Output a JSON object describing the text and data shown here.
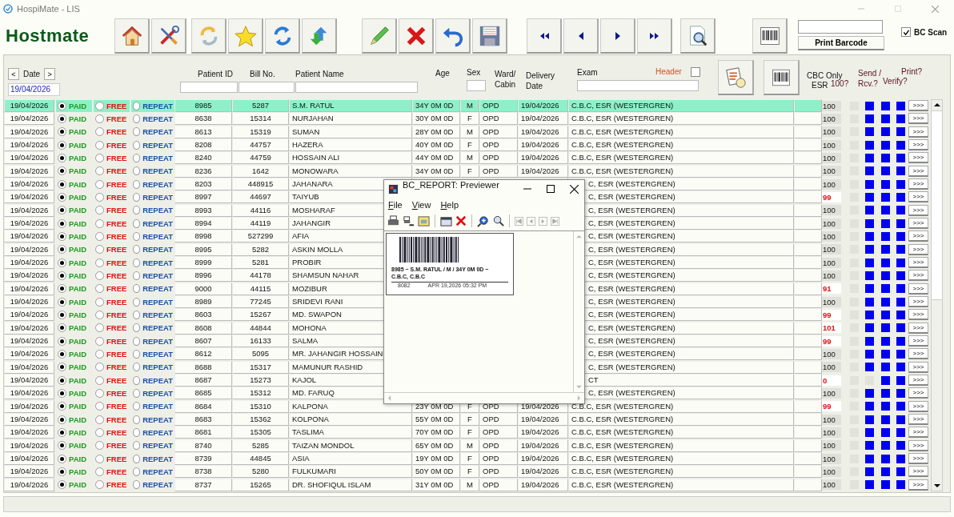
{
  "window": {
    "title": "HospiMate - LIS"
  },
  "logo": "Hostmate",
  "print_barcode_button": "Print Barcode",
  "bc_scan": {
    "label": "BC Scan",
    "checked": true
  },
  "date_nav": {
    "prev": "<",
    "label": "Date",
    "next": ">",
    "value": "19/04/2026"
  },
  "columns": {
    "patient_id": "Patient ID",
    "bill_no": "Bill No.",
    "patient_name": "Patient Name",
    "age": "Age",
    "sex": "Sex",
    "ward": "Ward/ Cabin",
    "delivery": "Delivery Date",
    "exam": "Exam",
    "cbc": "CBC Only",
    "esr": "ESR",
    "hundred": "100?",
    "send": "Send / Rcv.?",
    "print": "Print?",
    "verify": "Verify?"
  },
  "header_toggle": {
    "label": "Header",
    "checked": false
  },
  "rows": [
    {
      "date": "19/04/2026",
      "selected": true,
      "payment": [
        {
          "kind": "paid",
          "label": "PAID",
          "selected": true
        },
        {
          "kind": "free",
          "label": "FREE",
          "selected": false
        },
        {
          "kind": "repeat",
          "label": "REPEAT",
          "selected": false
        }
      ],
      "patient_id": "8985",
      "bill_no": "5287",
      "name": "S.M. RATUL",
      "age": "34Y 0M 0D",
      "sex": "M",
      "ward": "OPD",
      "delivery_date": "19/04/2026",
      "exam": "C.B.C, ESR (WESTERGREN)",
      "cbc": "100",
      "cbc_flag": false,
      "esr": false,
      "send": true,
      "receive": true,
      "verify": true,
      "action": ">>>"
    },
    {
      "date": "19/04/2026",
      "selected": false,
      "payment": [
        {
          "kind": "paid",
          "label": "PAID",
          "selected": true
        },
        {
          "kind": "free",
          "label": "FREE",
          "selected": false
        },
        {
          "kind": "repeat",
          "label": "REPEAT",
          "selected": false
        }
      ],
      "patient_id": "8638",
      "bill_no": "15314",
      "name": "NURJAHAN",
      "age": "30Y 0M 0D",
      "sex": "F",
      "ward": "OPD",
      "delivery_date": "19/04/2026",
      "exam": "C.B.C, ESR (WESTERGREN)",
      "cbc": "100",
      "cbc_flag": false,
      "esr": false,
      "send": true,
      "receive": true,
      "verify": true,
      "action": ">>>"
    },
    {
      "date": "19/04/2026",
      "selected": false,
      "payment": [
        {
          "kind": "paid",
          "label": "PAID",
          "selected": true
        },
        {
          "kind": "free",
          "label": "FREE",
          "selected": false
        },
        {
          "kind": "repeat",
          "label": "REPEAT",
          "selected": false
        }
      ],
      "patient_id": "8613",
      "bill_no": "15319",
      "name": "SUMAN",
      "age": "28Y 0M 0D",
      "sex": "M",
      "ward": "OPD",
      "delivery_date": "19/04/2026",
      "exam": "C.B.C, ESR (WESTERGREN)",
      "cbc": "100",
      "cbc_flag": false,
      "esr": false,
      "send": true,
      "receive": true,
      "verify": true,
      "action": ">>>"
    },
    {
      "date": "19/04/2026",
      "selected": false,
      "payment": [
        {
          "kind": "paid",
          "label": "PAID",
          "selected": true
        },
        {
          "kind": "free",
          "label": "FREE",
          "selected": false
        },
        {
          "kind": "repeat",
          "label": "REPEAT",
          "selected": false
        }
      ],
      "patient_id": "8208",
      "bill_no": "44757",
      "name": "HAZERA",
      "age": "40Y 0M 0D",
      "sex": "F",
      "ward": "OPD",
      "delivery_date": "19/04/2026",
      "exam": "C.B.C, ESR (WESTERGREN)",
      "cbc": "100",
      "cbc_flag": false,
      "esr": false,
      "send": true,
      "receive": true,
      "verify": true,
      "action": ">>>"
    },
    {
      "date": "19/04/2026",
      "selected": false,
      "payment": [
        {
          "kind": "paid",
          "label": "PAID",
          "selected": true
        },
        {
          "kind": "free",
          "label": "FREE",
          "selected": false
        },
        {
          "kind": "repeat",
          "label": "REPEAT",
          "selected": false
        }
      ],
      "patient_id": "8240",
      "bill_no": "44759",
      "name": "HOSSAIN ALI",
      "age": "44Y 0M 0D",
      "sex": "M",
      "ward": "OPD",
      "delivery_date": "19/04/2026",
      "exam": "C.B.C, ESR (WESTERGREN)",
      "cbc": "100",
      "cbc_flag": false,
      "esr": false,
      "send": true,
      "receive": true,
      "verify": true,
      "action": ">>>"
    },
    {
      "date": "19/04/2026",
      "selected": false,
      "payment": [
        {
          "kind": "paid",
          "label": "PAID",
          "selected": true
        },
        {
          "kind": "free",
          "label": "FREE",
          "selected": false
        },
        {
          "kind": "repeat",
          "label": "REPEAT",
          "selected": false
        }
      ],
      "patient_id": "8236",
      "bill_no": "1642",
      "name": "MONOWARA",
      "age": "34Y 0M 0D",
      "sex": "F",
      "ward": "OPD",
      "delivery_date": "19/04/2026",
      "exam": "C.B.C, ESR (WESTERGREN)",
      "cbc": "100",
      "cbc_flag": false,
      "esr": false,
      "send": true,
      "receive": true,
      "verify": true,
      "action": ">>>"
    },
    {
      "date": "19/04/2026",
      "selected": false,
      "payment": [
        {
          "kind": "paid",
          "label": "PAID",
          "selected": true
        },
        {
          "kind": "free",
          "label": "FREE",
          "selected": false
        },
        {
          "kind": "repeat",
          "label": "REPEAT",
          "selected": false
        }
      ],
      "patient_id": "8203",
      "bill_no": "448915",
      "name": "JAHANARA",
      "exam": "C, ESR (WESTERGREN)",
      "cbc": "100",
      "cbc_flag": false,
      "esr": false,
      "send": true,
      "receive": true,
      "verify": true,
      "action": ">>>"
    },
    {
      "date": "19/04/2026",
      "selected": false,
      "payment": [
        {
          "kind": "paid",
          "label": "PAID",
          "selected": true
        },
        {
          "kind": "free",
          "label": "FREE",
          "selected": false
        },
        {
          "kind": "repeat",
          "label": "REPEAT",
          "selected": false
        }
      ],
      "patient_id": "8997",
      "bill_no": "44697",
      "name": "TAIYUB",
      "exam": "C, ESR (WESTERGREN)",
      "cbc": "99",
      "cbc_flag": true,
      "esr": false,
      "send": true,
      "receive": true,
      "verify": true,
      "action": ">>>"
    },
    {
      "date": "19/04/2026",
      "selected": false,
      "payment": [
        {
          "kind": "paid",
          "label": "PAID",
          "selected": true
        },
        {
          "kind": "free",
          "label": "FREE",
          "selected": false
        },
        {
          "kind": "repeat",
          "label": "REPEAT",
          "selected": false
        }
      ],
      "patient_id": "8993",
      "bill_no": "44116",
      "name": "MOSHARAF",
      "exam": "C, ESR (WESTERGREN)",
      "cbc": "100",
      "cbc_flag": false,
      "esr": false,
      "send": true,
      "receive": true,
      "verify": true,
      "action": ">>>"
    },
    {
      "date": "19/04/2026",
      "selected": false,
      "payment": [
        {
          "kind": "paid",
          "label": "PAID",
          "selected": true
        },
        {
          "kind": "free",
          "label": "FREE",
          "selected": false
        },
        {
          "kind": "repeat",
          "label": "REPEAT",
          "selected": false
        }
      ],
      "patient_id": "8994",
      "bill_no": "44119",
      "name": "JAHANGIR",
      "exam": "C, ESR (WESTERGREN)",
      "cbc": "100",
      "cbc_flag": false,
      "esr": false,
      "send": true,
      "receive": true,
      "verify": true,
      "action": ">>>"
    },
    {
      "date": "19/04/2026",
      "selected": false,
      "payment": [
        {
          "kind": "paid",
          "label": "PAID",
          "selected": true
        },
        {
          "kind": "free",
          "label": "FREE",
          "selected": false
        },
        {
          "kind": "repeat",
          "label": "REPEAT",
          "selected": false
        }
      ],
      "patient_id": "8998",
      "bill_no": "527299",
      "name": "AFIA",
      "exam": "C, ESR (WESTERGREN)",
      "cbc": "100",
      "cbc_flag": false,
      "esr": false,
      "send": true,
      "receive": true,
      "verify": true,
      "action": ">>>"
    },
    {
      "date": "19/04/2026",
      "selected": false,
      "payment": [
        {
          "kind": "paid",
          "label": "PAID",
          "selected": true
        },
        {
          "kind": "free",
          "label": "FREE",
          "selected": false
        },
        {
          "kind": "repeat",
          "label": "REPEAT",
          "selected": false
        }
      ],
      "patient_id": "8995",
      "bill_no": "5282",
      "name": "ASKIN MOLLA",
      "exam": "C, ESR (WESTERGREN)",
      "cbc": "100",
      "cbc_flag": false,
      "esr": false,
      "send": true,
      "receive": true,
      "verify": true,
      "action": ">>>"
    },
    {
      "date": "19/04/2026",
      "selected": false,
      "payment": [
        {
          "kind": "paid",
          "label": "PAID",
          "selected": true
        },
        {
          "kind": "free",
          "label": "FREE",
          "selected": false
        },
        {
          "kind": "repeat",
          "label": "REPEAT",
          "selected": false
        }
      ],
      "patient_id": "8999",
      "bill_no": "5281",
      "name": "PROBIR",
      "exam": "C, ESR (WESTERGREN)",
      "cbc": "100",
      "cbc_flag": false,
      "esr": false,
      "send": true,
      "receive": true,
      "verify": true,
      "action": ">>>"
    },
    {
      "date": "19/04/2026",
      "selected": false,
      "payment": [
        {
          "kind": "paid",
          "label": "PAID",
          "selected": true
        },
        {
          "kind": "free",
          "label": "FREE",
          "selected": false
        },
        {
          "kind": "repeat",
          "label": "REPEAT",
          "selected": false
        }
      ],
      "patient_id": "8996",
      "bill_no": "44178",
      "name": "SHAMSUN NAHAR",
      "exam": "C, ESR (WESTERGREN)",
      "cbc": "100",
      "cbc_flag": false,
      "esr": false,
      "send": true,
      "receive": true,
      "verify": true,
      "action": ">>>"
    },
    {
      "date": "19/04/2026",
      "selected": false,
      "payment": [
        {
          "kind": "paid",
          "label": "PAID",
          "selected": true
        },
        {
          "kind": "free",
          "label": "FREE",
          "selected": false
        },
        {
          "kind": "repeat",
          "label": "REPEAT",
          "selected": false
        }
      ],
      "patient_id": "9000",
      "bill_no": "44115",
      "name": "MOZIBUR",
      "exam": "C, ESR (WESTERGREN)",
      "cbc": "91",
      "cbc_flag": true,
      "esr": false,
      "send": true,
      "receive": true,
      "verify": true,
      "action": ">>>"
    },
    {
      "date": "19/04/2026",
      "selected": false,
      "payment": [
        {
          "kind": "paid",
          "label": "PAID",
          "selected": true
        },
        {
          "kind": "free",
          "label": "FREE",
          "selected": false
        },
        {
          "kind": "repeat",
          "label": "REPEAT",
          "selected": false
        }
      ],
      "patient_id": "8989",
      "bill_no": "77245",
      "name": "SRIDEVI RANI",
      "exam": "C, ESR (WESTERGREN)",
      "cbc": "100",
      "cbc_flag": false,
      "esr": false,
      "send": true,
      "receive": true,
      "verify": true,
      "action": ">>>"
    },
    {
      "date": "19/04/2026",
      "selected": false,
      "payment": [
        {
          "kind": "paid",
          "label": "PAID",
          "selected": true
        },
        {
          "kind": "free",
          "label": "FREE",
          "selected": false
        },
        {
          "kind": "repeat",
          "label": "REPEAT",
          "selected": false
        }
      ],
      "patient_id": "8603",
      "bill_no": "15267",
      "name": "MD. SWAPON",
      "exam": "C, ESR (WESTERGREN)",
      "cbc": "99",
      "cbc_flag": true,
      "esr": false,
      "send": true,
      "receive": true,
      "verify": true,
      "action": ">>>"
    },
    {
      "date": "19/04/2026",
      "selected": false,
      "payment": [
        {
          "kind": "paid",
          "label": "PAID",
          "selected": true
        },
        {
          "kind": "free",
          "label": "FREE",
          "selected": false
        },
        {
          "kind": "repeat",
          "label": "REPEAT",
          "selected": false
        }
      ],
      "patient_id": "8608",
      "bill_no": "44844",
      "name": "MOHONA",
      "exam": "C, ESR (WESTERGREN)",
      "cbc": "101",
      "cbc_flag": true,
      "esr": false,
      "send": true,
      "receive": true,
      "verify": true,
      "action": ">>>"
    },
    {
      "date": "19/04/2026",
      "selected": false,
      "payment": [
        {
          "kind": "paid",
          "label": "PAID",
          "selected": true
        },
        {
          "kind": "free",
          "label": "FREE",
          "selected": false
        },
        {
          "kind": "repeat",
          "label": "REPEAT",
          "selected": false
        }
      ],
      "patient_id": "8607",
      "bill_no": "16133",
      "name": "SALMA",
      "exam": "C, ESR (WESTERGREN)",
      "cbc": "99",
      "cbc_flag": true,
      "esr": false,
      "send": true,
      "receive": true,
      "verify": true,
      "action": ">>>"
    },
    {
      "date": "19/04/2026",
      "selected": false,
      "payment": [
        {
          "kind": "paid",
          "label": "PAID",
          "selected": true
        },
        {
          "kind": "free",
          "label": "FREE",
          "selected": false
        },
        {
          "kind": "repeat",
          "label": "REPEAT",
          "selected": false
        }
      ],
      "patient_id": "8612",
      "bill_no": "5095",
      "name": "MR. JAHANGIR HOSSAIN",
      "exam": "C, ESR (WESTERGREN)",
      "cbc": "100",
      "cbc_flag": false,
      "esr": false,
      "send": true,
      "receive": true,
      "verify": true,
      "action": ">>>"
    },
    {
      "date": "19/04/2026",
      "selected": false,
      "payment": [
        {
          "kind": "paid",
          "label": "PAID",
          "selected": true
        },
        {
          "kind": "free",
          "label": "FREE",
          "selected": false
        },
        {
          "kind": "repeat",
          "label": "REPEAT",
          "selected": false
        }
      ],
      "patient_id": "8688",
      "bill_no": "15317",
      "name": "MAMUNUR RASHID",
      "exam": "C, ESR (WESTERGREN)",
      "cbc": "100",
      "cbc_flag": false,
      "esr": false,
      "send": true,
      "receive": true,
      "verify": true,
      "action": ">>>"
    },
    {
      "date": "19/04/2026",
      "selected": false,
      "payment": [
        {
          "kind": "paid",
          "label": "PAID",
          "selected": true
        },
        {
          "kind": "free",
          "label": "FREE",
          "selected": false
        },
        {
          "kind": "repeat",
          "label": "REPEAT",
          "selected": false
        }
      ],
      "patient_id": "8687",
      "bill_no": "15273",
      "name": "KAJOL",
      "exam": "CT",
      "cbc": "0",
      "cbc_flag": true,
      "esr": false,
      "send": false,
      "receive": true,
      "verify": true,
      "action": ">>>"
    },
    {
      "date": "19/04/2026",
      "selected": false,
      "payment": [
        {
          "kind": "paid",
          "label": "PAID",
          "selected": true
        },
        {
          "kind": "free",
          "label": "FREE",
          "selected": false
        },
        {
          "kind": "repeat",
          "label": "REPEAT",
          "selected": false
        }
      ],
      "patient_id": "8685",
      "bill_no": "15312",
      "name": "MD. FARUQ",
      "exam": "C, ESR (WESTERGREN)",
      "cbc": "100",
      "cbc_flag": false,
      "esr": false,
      "send": true,
      "receive": true,
      "verify": true,
      "action": ">>>"
    },
    {
      "date": "19/04/2026",
      "selected": false,
      "payment": [
        {
          "kind": "paid",
          "label": "PAID",
          "selected": true
        },
        {
          "kind": "free",
          "label": "FREE",
          "selected": false
        },
        {
          "kind": "repeat",
          "label": "REPEAT",
          "selected": false
        }
      ],
      "patient_id": "8684",
      "bill_no": "15310",
      "name": "KALPONA",
      "age": "23Y 0M 0D",
      "sex": "F",
      "ward": "OPD",
      "delivery_date": "19/04/2026",
      "exam": "C.B.C, ESR (WESTERGREN)",
      "cbc": "99",
      "cbc_flag": true,
      "esr": false,
      "send": true,
      "receive": true,
      "verify": true,
      "action": ">>>"
    },
    {
      "date": "19/04/2026",
      "selected": false,
      "payment": [
        {
          "kind": "paid",
          "label": "PAID",
          "selected": true
        },
        {
          "kind": "free",
          "label": "FREE",
          "selected": false
        },
        {
          "kind": "repeat",
          "label": "REPEAT",
          "selected": false
        }
      ],
      "patient_id": "8683",
      "bill_no": "15362",
      "name": "KOLPONA",
      "age": "55Y 0M 0D",
      "sex": "F",
      "ward": "OPD",
      "delivery_date": "19/04/2026",
      "exam": "C.B.C, ESR (WESTERGREN)",
      "cbc": "100",
      "cbc_flag": false,
      "esr": false,
      "send": true,
      "receive": true,
      "verify": true,
      "action": ">>>"
    },
    {
      "date": "19/04/2026",
      "selected": false,
      "payment": [
        {
          "kind": "paid",
          "label": "PAID",
          "selected": true
        },
        {
          "kind": "free",
          "label": "FREE",
          "selected": false
        },
        {
          "kind": "repeat",
          "label": "REPEAT",
          "selected": false
        }
      ],
      "patient_id": "8681",
      "bill_no": "15305",
      "name": "TASLIMA",
      "age": "70Y 0M 0D",
      "sex": "F",
      "ward": "OPD",
      "delivery_date": "19/04/2026",
      "exam": "C.B.C, ESR (WESTERGREN)",
      "cbc": "100",
      "cbc_flag": false,
      "esr": false,
      "send": true,
      "receive": true,
      "verify": true,
      "action": ">>>"
    },
    {
      "date": "19/04/2026",
      "selected": false,
      "payment": [
        {
          "kind": "paid",
          "label": "PAID",
          "selected": true
        },
        {
          "kind": "free",
          "label": "FREE",
          "selected": false
        },
        {
          "kind": "repeat",
          "label": "REPEAT",
          "selected": false
        }
      ],
      "patient_id": "8740",
      "bill_no": "5285",
      "name": "TAIZAN MONDOL",
      "age": "65Y 0M 0D",
      "sex": "M",
      "ward": "OPD",
      "delivery_date": "19/04/2026",
      "exam": "C.B.C, ESR (WESTERGREN)",
      "cbc": "100",
      "cbc_flag": false,
      "esr": false,
      "send": true,
      "receive": true,
      "verify": true,
      "action": ">>>"
    },
    {
      "date": "19/04/2026",
      "selected": false,
      "payment": [
        {
          "kind": "paid",
          "label": "PAID",
          "selected": true
        },
        {
          "kind": "free",
          "label": "FREE",
          "selected": false
        },
        {
          "kind": "repeat",
          "label": "REPEAT",
          "selected": false
        }
      ],
      "patient_id": "8739",
      "bill_no": "44845",
      "name": "ASIA",
      "age": "19Y 0M 0D",
      "sex": "F",
      "ward": "OPD",
      "delivery_date": "19/04/2026",
      "exam": "C.B.C, ESR (WESTERGREN)",
      "cbc": "100",
      "cbc_flag": false,
      "esr": false,
      "send": true,
      "receive": true,
      "verify": true,
      "action": ">>>"
    },
    {
      "date": "19/04/2026",
      "selected": false,
      "payment": [
        {
          "kind": "paid",
          "label": "PAID",
          "selected": true
        },
        {
          "kind": "free",
          "label": "FREE",
          "selected": false
        },
        {
          "kind": "repeat",
          "label": "REPEAT",
          "selected": false
        }
      ],
      "patient_id": "8738",
      "bill_no": "5280",
      "name": "FULKUMARI",
      "age": "50Y 0M 0D",
      "sex": "F",
      "ward": "OPD",
      "delivery_date": "19/04/2026",
      "exam": "C.B.C, ESR (WESTERGREN)",
      "cbc": "100",
      "cbc_flag": false,
      "esr": false,
      "send": true,
      "receive": true,
      "verify": true,
      "action": ">>>"
    },
    {
      "date": "19/04/2026",
      "selected": false,
      "payment": [
        {
          "kind": "paid",
          "label": "PAID",
          "selected": true
        },
        {
          "kind": "free",
          "label": "FREE",
          "selected": false
        },
        {
          "kind": "repeat",
          "label": "REPEAT",
          "selected": false
        }
      ],
      "patient_id": "8737",
      "bill_no": "15265",
      "name": "DR. SHOFIQUL ISLAM",
      "age": "31Y 0M 0D",
      "sex": "M",
      "ward": "OPD",
      "delivery_date": "19/04/2026",
      "exam": "C.B.C, ESR (WESTERGREN)",
      "cbc": "100",
      "cbc_flag": false,
      "esr": false,
      "send": true,
      "receive": true,
      "verify": true,
      "action": ">>>"
    }
  ],
  "previewer": {
    "title": "BC_REPORT: Previewer",
    "menu": [
      "File",
      "View",
      "Help"
    ],
    "label_text": "8985 ~ S.M. RATUL / M / 34Y 0M 0D ~ C.B.C, C.B.C",
    "label_code": "8082",
    "label_printed": "APR 19,2026 05:32 PM"
  }
}
